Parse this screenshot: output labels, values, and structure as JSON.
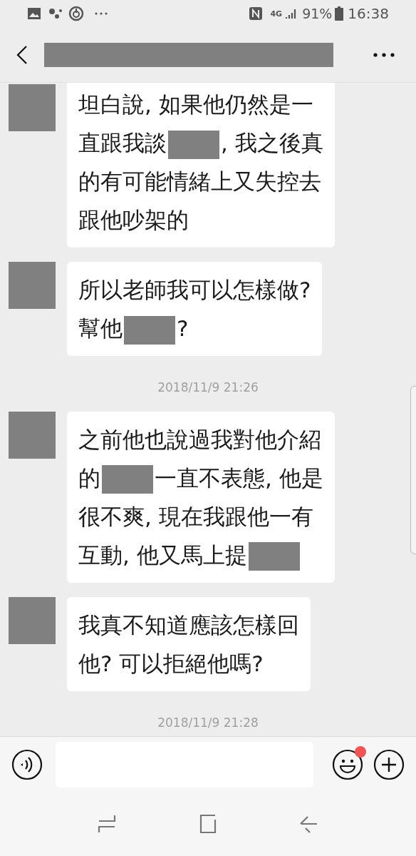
{
  "status_bar": {
    "network": "4G",
    "battery": "91%",
    "time": "16:38"
  },
  "header": {
    "title_redacted": true
  },
  "messages": [
    {
      "kind": "message",
      "lines": [
        [
          {
            "kind": "text",
            "text": "坦白說, 如果他仍然是一"
          }
        ],
        [
          {
            "kind": "text",
            "text": "直跟我談"
          },
          {
            "kind": "redacted"
          },
          {
            "kind": "text",
            "text": ", 我之後真"
          }
        ],
        [
          {
            "kind": "text",
            "text": "的有可能情緒上又失控去"
          }
        ],
        [
          {
            "kind": "text",
            "text": "跟他吵架的"
          }
        ]
      ]
    },
    {
      "kind": "message",
      "lines": [
        [
          {
            "kind": "text",
            "text": "所以老師我可以怎樣做?"
          }
        ],
        [
          {
            "kind": "text",
            "text": "幫他"
          },
          {
            "kind": "redacted"
          },
          {
            "kind": "text",
            "text": "?"
          }
        ]
      ]
    },
    {
      "kind": "time",
      "text": "2018/11/9 21:26"
    },
    {
      "kind": "message",
      "lines": [
        [
          {
            "kind": "text",
            "text": "之前他也說過我對他介紹"
          }
        ],
        [
          {
            "kind": "text",
            "text": "的"
          },
          {
            "kind": "redacted"
          },
          {
            "kind": "text",
            "text": "一直不表態, 他是"
          }
        ],
        [
          {
            "kind": "text",
            "text": "很不爽, 現在我跟他一有"
          }
        ],
        [
          {
            "kind": "text",
            "text": "互動, 他又馬上提"
          },
          {
            "kind": "redacted"
          }
        ]
      ]
    },
    {
      "kind": "message",
      "lines": [
        [
          {
            "kind": "text",
            "text": "我真不知道應該怎樣回"
          }
        ],
        [
          {
            "kind": "text",
            "text": "他? 可以拒絕他嗎?"
          }
        ]
      ]
    },
    {
      "kind": "time",
      "text": "2018/11/9 21:28"
    }
  ],
  "input_bar": {
    "emoji_badge": true
  }
}
